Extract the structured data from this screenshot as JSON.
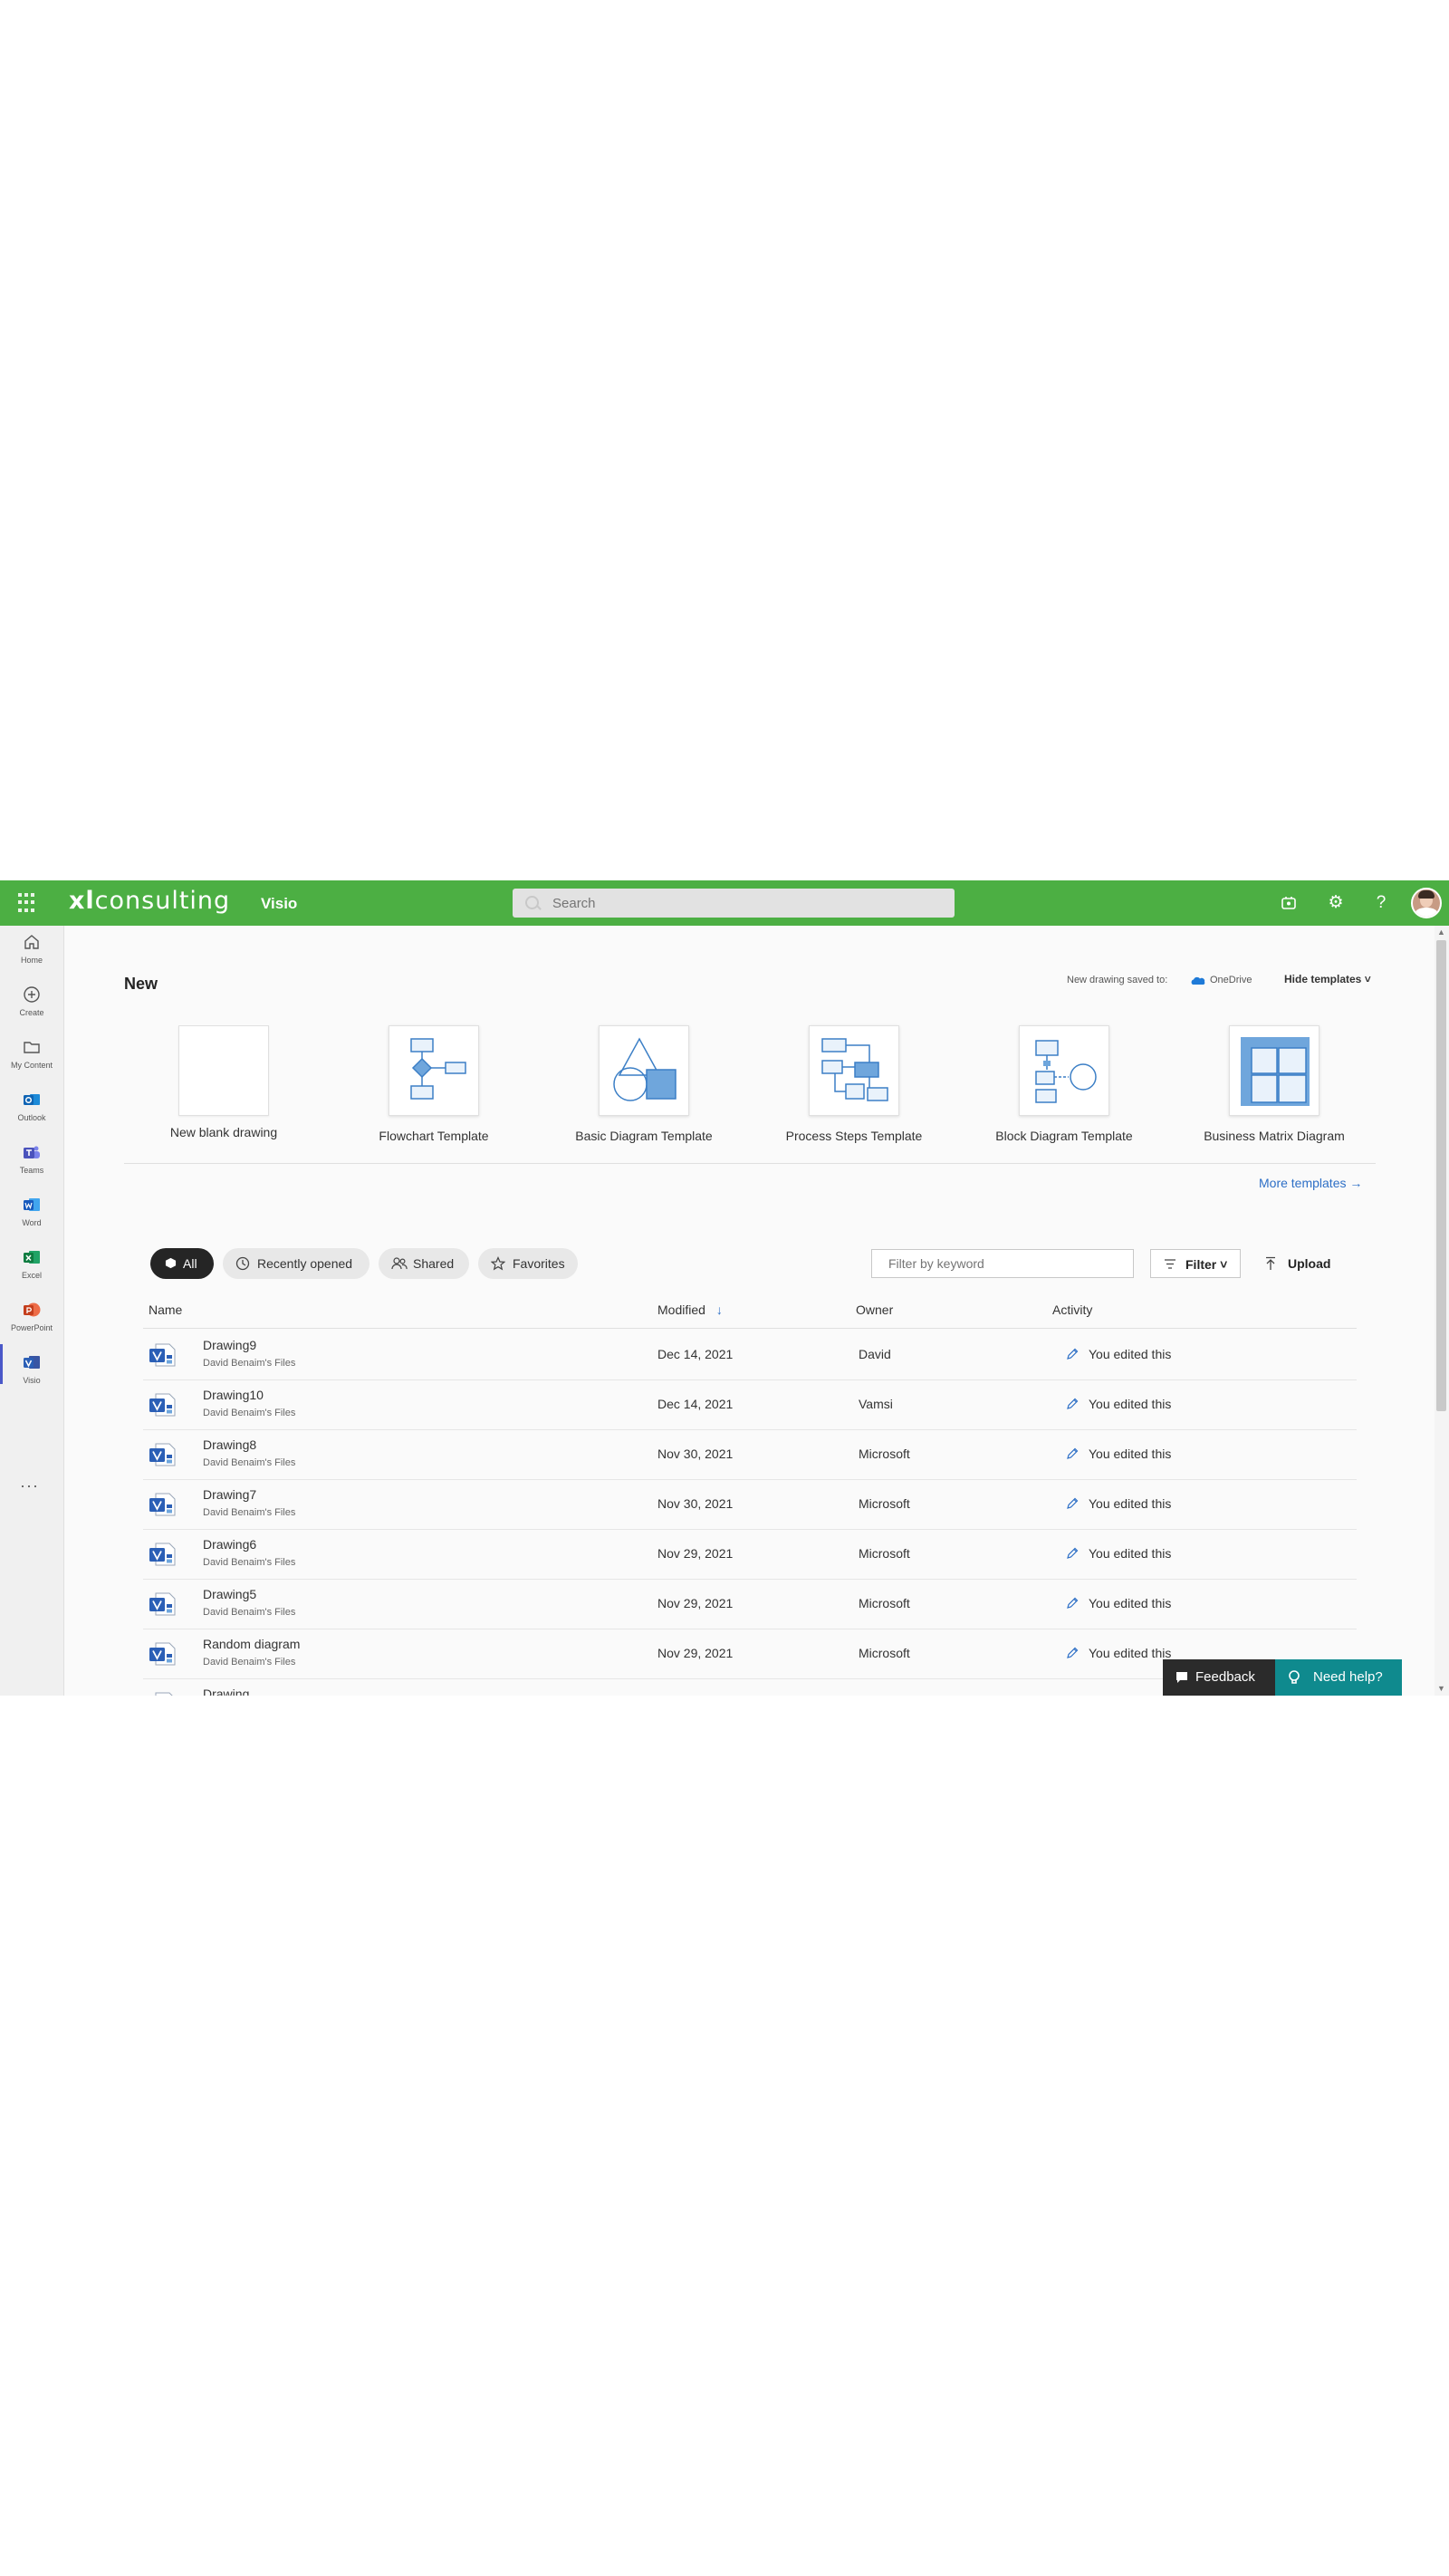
{
  "topbar": {
    "brand_prefix": "xl",
    "brand_suffix": "consulting",
    "app_name": "Visio",
    "search_placeholder": "Search"
  },
  "rail": {
    "items": [
      {
        "label": "Home",
        "icon": "home-icon"
      },
      {
        "label": "Create",
        "icon": "create-icon"
      },
      {
        "label": "My Content",
        "icon": "folder-icon"
      },
      {
        "label": "Outlook",
        "icon": "outlook-icon"
      },
      {
        "label": "Teams",
        "icon": "teams-icon"
      },
      {
        "label": "Word",
        "icon": "word-icon"
      },
      {
        "label": "Excel",
        "icon": "excel-icon"
      },
      {
        "label": "PowerPoint",
        "icon": "powerpoint-icon"
      },
      {
        "label": "Visio",
        "icon": "visio-icon"
      }
    ],
    "more": "···"
  },
  "new_section": {
    "title": "New",
    "saved_to_label": "New drawing saved to:",
    "saved_to_location": "OneDrive",
    "hide_templates": "Hide templates ˅",
    "templates": [
      "New blank drawing",
      "Flowchart Template",
      "Basic Diagram Template",
      "Process Steps Template",
      "Block Diagram Template",
      "Business Matrix Diagram"
    ],
    "more_templates": "More templates →"
  },
  "filters": {
    "all": "All",
    "recently_opened": "Recently opened",
    "shared": "Shared",
    "favorites": "Favorites",
    "keyword_placeholder": "Filter by keyword",
    "filter": "Filter ˅",
    "upload": "Upload"
  },
  "table": {
    "headers": {
      "name": "Name",
      "modified": "Modified",
      "owner": "Owner",
      "activity": "Activity"
    },
    "rows": [
      {
        "name": "Drawing9",
        "location": "David Benaim's Files",
        "modified": "Dec 14, 2021",
        "owner": "David",
        "activity": "You edited this"
      },
      {
        "name": "Drawing10",
        "location": "David Benaim's Files",
        "modified": "Dec 14, 2021",
        "owner": "Vamsi",
        "activity": "You edited this"
      },
      {
        "name": "Drawing8",
        "location": "David Benaim's Files",
        "modified": "Nov 30, 2021",
        "owner": "Microsoft",
        "activity": "You edited this"
      },
      {
        "name": "Drawing7",
        "location": "David Benaim's Files",
        "modified": "Nov 30, 2021",
        "owner": "Microsoft",
        "activity": "You edited this"
      },
      {
        "name": "Drawing6",
        "location": "David Benaim's Files",
        "modified": "Nov 29, 2021",
        "owner": "Microsoft",
        "activity": "You edited this"
      },
      {
        "name": "Drawing5",
        "location": "David Benaim's Files",
        "modified": "Nov 29, 2021",
        "owner": "Microsoft",
        "activity": "You edited this"
      },
      {
        "name": "Random diagram",
        "location": "David Benaim's Files",
        "modified": "Nov 29, 2021",
        "owner": "Microsoft",
        "activity": "You edited this"
      },
      {
        "name": "Drawing",
        "location": "",
        "modified": "",
        "owner": "",
        "activity": ""
      }
    ]
  },
  "footer": {
    "feedback": "Feedback",
    "need_help": "Need help?"
  },
  "colors": {
    "topbar": "#4caf43",
    "accent_link": "#2d6fc6",
    "visio_blue": "#2b5fb6",
    "need_help_bg": "#0f8a8e"
  }
}
